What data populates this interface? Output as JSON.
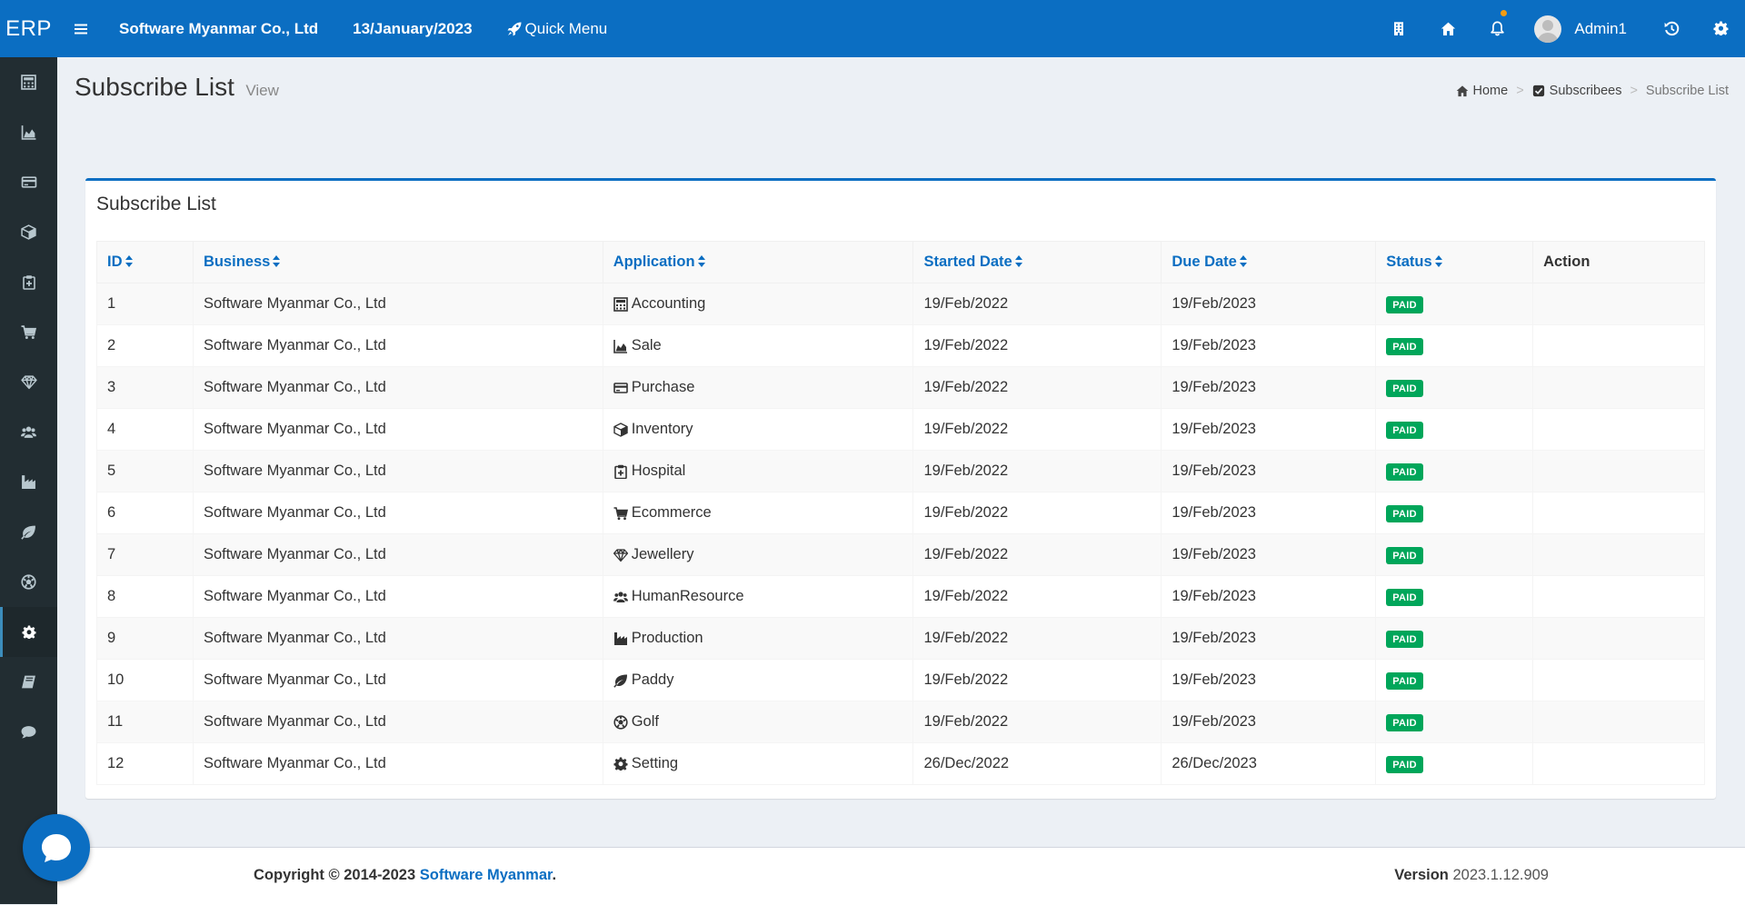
{
  "topbar": {
    "logo": "ERP",
    "company": "Software Myanmar Co., Ltd",
    "date": "13/January/2023",
    "quick_menu": "Quick Menu",
    "user": "Admin1",
    "colors": {
      "primary": "#0b6ec2",
      "notification_dot": "#f39c12"
    }
  },
  "sidebar": {
    "items": [
      {
        "icon": "calculator-icon"
      },
      {
        "icon": "area-chart-icon"
      },
      {
        "icon": "credit-card-icon"
      },
      {
        "icon": "cube-icon"
      },
      {
        "icon": "clipboard-icon"
      },
      {
        "icon": "cart-icon"
      },
      {
        "icon": "diamond-icon"
      },
      {
        "icon": "users-icon"
      },
      {
        "icon": "industry-icon"
      },
      {
        "icon": "leaf-icon"
      },
      {
        "icon": "soccer-ball-icon"
      },
      {
        "icon": "gear-icon",
        "active": true
      },
      {
        "icon": "book-icon"
      },
      {
        "icon": "comment-icon"
      }
    ]
  },
  "header": {
    "title": "Subscribe List",
    "subtitle": "View",
    "breadcrumb": {
      "home": "Home",
      "section": "Subscribees",
      "current": "Subscribe List"
    }
  },
  "box": {
    "title": "Subscribe List",
    "columns": {
      "id": "ID",
      "business": "Business",
      "application": "Application",
      "started": "Started Date",
      "due": "Due Date",
      "status": "Status",
      "action": "Action"
    },
    "rows": [
      {
        "id": "1",
        "business": "Software Myanmar Co., Ltd",
        "application": "Accounting",
        "app_icon": "calculator-icon",
        "started": "19/Feb/2022",
        "due": "19/Feb/2023",
        "status": "PAID"
      },
      {
        "id": "2",
        "business": "Software Myanmar Co., Ltd",
        "application": "Sale",
        "app_icon": "area-chart-icon",
        "started": "19/Feb/2022",
        "due": "19/Feb/2023",
        "status": "PAID"
      },
      {
        "id": "3",
        "business": "Software Myanmar Co., Ltd",
        "application": "Purchase",
        "app_icon": "credit-card-icon",
        "started": "19/Feb/2022",
        "due": "19/Feb/2023",
        "status": "PAID"
      },
      {
        "id": "4",
        "business": "Software Myanmar Co., Ltd",
        "application": "Inventory",
        "app_icon": "cube-icon",
        "started": "19/Feb/2022",
        "due": "19/Feb/2023",
        "status": "PAID"
      },
      {
        "id": "5",
        "business": "Software Myanmar Co., Ltd",
        "application": "Hospital",
        "app_icon": "clipboard-icon",
        "started": "19/Feb/2022",
        "due": "19/Feb/2023",
        "status": "PAID"
      },
      {
        "id": "6",
        "business": "Software Myanmar Co., Ltd",
        "application": "Ecommerce",
        "app_icon": "cart-icon",
        "started": "19/Feb/2022",
        "due": "19/Feb/2023",
        "status": "PAID"
      },
      {
        "id": "7",
        "business": "Software Myanmar Co., Ltd",
        "application": "Jewellery",
        "app_icon": "diamond-icon",
        "started": "19/Feb/2022",
        "due": "19/Feb/2023",
        "status": "PAID"
      },
      {
        "id": "8",
        "business": "Software Myanmar Co., Ltd",
        "application": "HumanResource",
        "app_icon": "users-icon",
        "started": "19/Feb/2022",
        "due": "19/Feb/2023",
        "status": "PAID"
      },
      {
        "id": "9",
        "business": "Software Myanmar Co., Ltd",
        "application": "Production",
        "app_icon": "industry-icon",
        "started": "19/Feb/2022",
        "due": "19/Feb/2023",
        "status": "PAID"
      },
      {
        "id": "10",
        "business": "Software Myanmar Co., Ltd",
        "application": "Paddy",
        "app_icon": "leaf-icon",
        "started": "19/Feb/2022",
        "due": "19/Feb/2023",
        "status": "PAID"
      },
      {
        "id": "11",
        "business": "Software Myanmar Co., Ltd",
        "application": "Golf",
        "app_icon": "soccer-ball-icon",
        "started": "19/Feb/2022",
        "due": "19/Feb/2023",
        "status": "PAID"
      },
      {
        "id": "12",
        "business": "Software Myanmar Co., Ltd",
        "application": "Setting",
        "app_icon": "gear-icon",
        "started": "26/Dec/2022",
        "due": "26/Dec/2023",
        "status": "PAID"
      }
    ],
    "status_color": "#00a65a"
  },
  "footer": {
    "copyright_prefix": "Copyright © 2014-2023",
    "copyright_link": "Software Myanmar",
    "copyright_suffix": ".",
    "version_label": "Version",
    "version_value": "2023.1.12.909"
  }
}
